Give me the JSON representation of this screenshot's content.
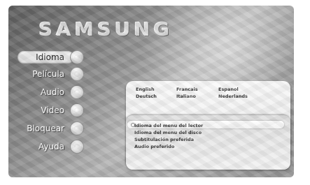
{
  "brand": {
    "logo_text": "SAMSUNG"
  },
  "menu": {
    "items": [
      {
        "label": "Idioma",
        "selected": true
      },
      {
        "label": "Película",
        "selected": false
      },
      {
        "label": "Audio",
        "selected": false
      },
      {
        "label": "Video",
        "selected": false
      },
      {
        "label": "Bloquear",
        "selected": false
      },
      {
        "label": "Ayuda",
        "selected": false
      }
    ]
  },
  "languages": {
    "items": [
      "English",
      "Francais",
      "Espanol",
      "Deutsch",
      "Italiano",
      "Nederlands"
    ]
  },
  "options": {
    "items": [
      "Idioma del menu del lector",
      "Idioma del menu del disco",
      "Subtitulación preferida",
      "Audio preferido"
    ],
    "selected_index": 0
  }
}
